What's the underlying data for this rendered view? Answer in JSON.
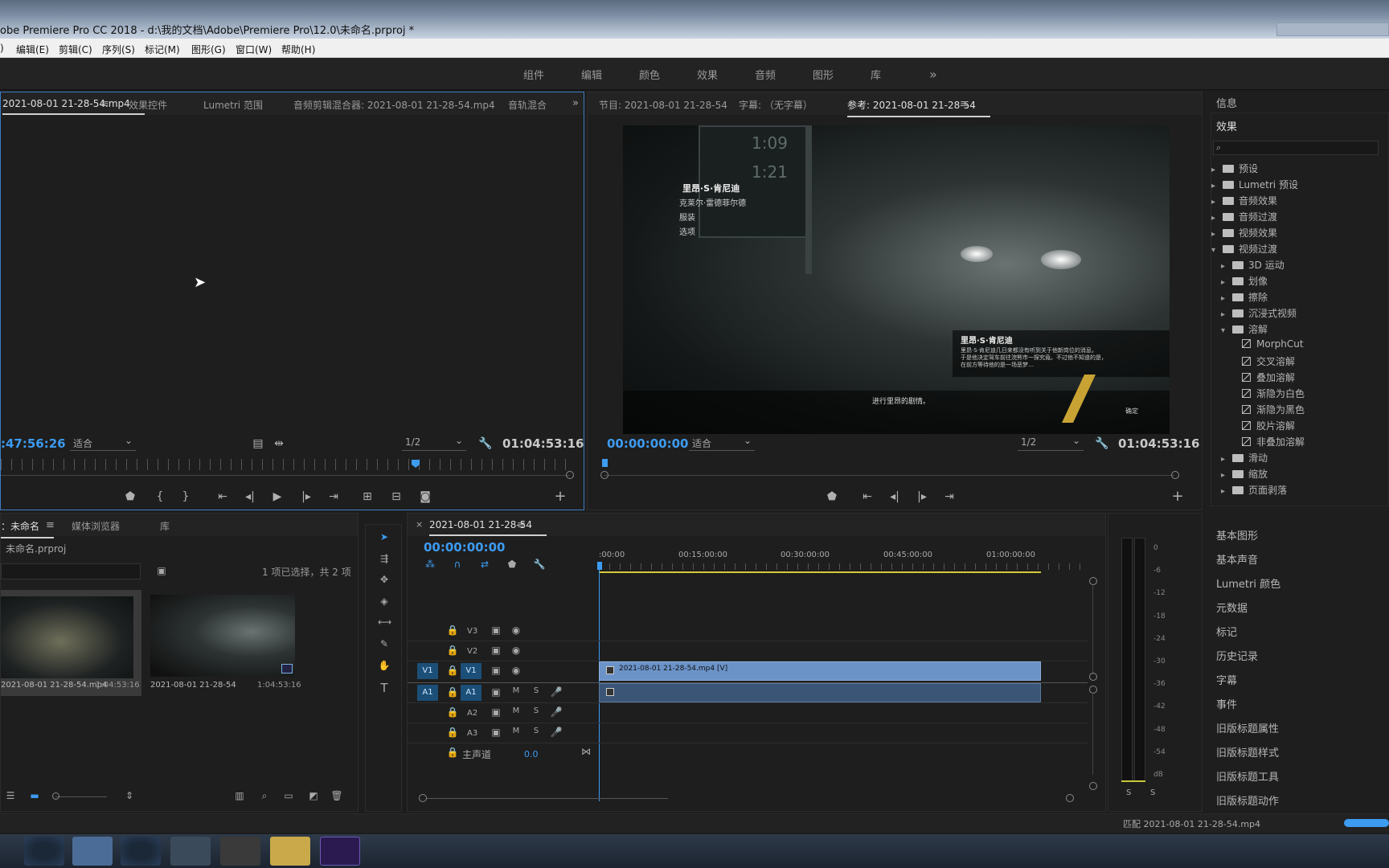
{
  "window": {
    "title": "obe Premiere Pro CC 2018 - d:\\我的文档\\Adobe\\Premiere Pro\\12.0\\未命名.prproj *"
  },
  "menu": {
    "items": [
      "编辑(E)",
      "剪辑(C)",
      "序列(S)",
      "标记(M)",
      "图形(G)",
      "窗口(W)",
      "帮助(H)"
    ],
    "first_mark": ")"
  },
  "workspaces": [
    "组件",
    "编辑",
    "颜色",
    "效果",
    "音频",
    "图形",
    "库"
  ],
  "source": {
    "tabs": [
      "2021-08-01 21-28-54.mp4",
      "效果控件",
      "Lumetri 范围",
      "音频剪辑混合器: 2021-08-01 21-28-54.mp4",
      "音轨混合"
    ],
    "timecode": ":47:56:26",
    "fit": "适合",
    "res": "1/2",
    "duration": "01:04:53:16"
  },
  "program": {
    "tabs": [
      "节目: 2021-08-01 21-28-54",
      "字幕: （无字幕）",
      "参考: 2021-08-01 21-28-54"
    ],
    "timecode": "00:00:00:00",
    "fit": "适合",
    "res": "1/2",
    "duration": "01:04:53:16",
    "frame": {
      "hud1": "1:09",
      "hud2": "1:21",
      "menu_title": "里昂·S·肯尼迪",
      "menu_items": [
        "克莱尔·雷德菲尔德",
        "服装",
        "选项"
      ],
      "dlg_title": "里昂·S·肯尼迪",
      "dlg_line1": "里昂·S·肯尼迪几日来都没有听到关于他新岗位的消息。",
      "dlg_line2": "于是他决定驾车前往浣熊市一探究竟。不过他不知道的是，",
      "dlg_line3": "在前方等待他的是一场恶梦…",
      "bottom": "进行里昂的剧情。",
      "confirm": "确定"
    }
  },
  "project": {
    "tabs": [
      "：未命名",
      "媒体浏览器",
      "库"
    ],
    "file": "未命名.prproj",
    "selection": "1 项已选择，共 2 项",
    "items": [
      {
        "name": "2021-08-01 21-28-54.mp4",
        "duration": "1:04:53:16"
      },
      {
        "name": "2021-08-01 21-28-54",
        "duration": "1:04:53:16"
      }
    ]
  },
  "timeline": {
    "tab": "2021-08-01 21-28-54",
    "timecode": "00:00:00:00",
    "ruler": [
      ":00:00",
      "00:15:00:00",
      "00:30:00:00",
      "00:45:00:00",
      "01:00:00:00"
    ],
    "video_tracks": [
      "V3",
      "V2",
      "V1"
    ],
    "audio_tracks": [
      "A1",
      "A2",
      "A3"
    ],
    "src_v": "V1",
    "src_a": "A1",
    "master": "主声道",
    "master_val": "0.0",
    "clip_v": "2021-08-01 21-28-54.mp4 [V]",
    "m": "M",
    "s": "S"
  },
  "meter": {
    "scale": [
      "0",
      "-6",
      "-12",
      "-18",
      "-24",
      "-30",
      "-36",
      "-42",
      "-48",
      "-54",
      "dB"
    ],
    "solo": [
      "S",
      "S"
    ]
  },
  "right": {
    "info": "信息",
    "effects": "效果",
    "tree": [
      {
        "t": "预设",
        "l": 0,
        "o": false
      },
      {
        "t": "Lumetri 预设",
        "l": 0,
        "o": false
      },
      {
        "t": "音频效果",
        "l": 0,
        "o": false
      },
      {
        "t": "音频过渡",
        "l": 0,
        "o": false
      },
      {
        "t": "视频效果",
        "l": 0,
        "o": false
      },
      {
        "t": "视频过渡",
        "l": 0,
        "o": true
      },
      {
        "t": "3D 运动",
        "l": 1,
        "o": false
      },
      {
        "t": "划像",
        "l": 1,
        "o": false
      },
      {
        "t": "擦除",
        "l": 1,
        "o": false
      },
      {
        "t": "沉浸式视频",
        "l": 1,
        "o": false
      },
      {
        "t": "溶解",
        "l": 1,
        "o": true
      },
      {
        "t": "MorphCut",
        "l": 2,
        "fx": true
      },
      {
        "t": "交叉溶解",
        "l": 2,
        "fx": true
      },
      {
        "t": "叠加溶解",
        "l": 2,
        "fx": true
      },
      {
        "t": "渐隐为白色",
        "l": 2,
        "fx": true
      },
      {
        "t": "渐隐为黑色",
        "l": 2,
        "fx": true
      },
      {
        "t": "胶片溶解",
        "l": 2,
        "fx": true
      },
      {
        "t": "非叠加溶解",
        "l": 2,
        "fx": true
      },
      {
        "t": "滑动",
        "l": 1,
        "o": false
      },
      {
        "t": "缩放",
        "l": 1,
        "o": false
      },
      {
        "t": "页面剥落",
        "l": 1,
        "o": false
      }
    ],
    "panels": [
      "基本图形",
      "基本声音",
      "Lumetri 颜色",
      "元数据",
      "标记",
      "历史记录",
      "字幕",
      "事件",
      "旧版标题属性",
      "旧版标题样式",
      "旧版标题工具",
      "旧版标题动作"
    ]
  },
  "status": {
    "text": "匹配 2021-08-01 21-28-54.mp4"
  },
  "colors": {
    "accent": "#3d9bf0",
    "clip_video": "#6b93c8",
    "clip_audio": "#3b5577",
    "track_btn": "#1b4f78"
  }
}
